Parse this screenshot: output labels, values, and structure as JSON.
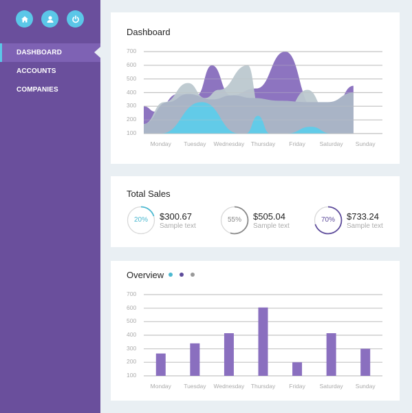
{
  "sidebar": {
    "icons": [
      {
        "name": "home-icon"
      },
      {
        "name": "user-icon"
      },
      {
        "name": "power-icon"
      }
    ],
    "items": [
      {
        "label": "DASHBOARD",
        "active": true
      },
      {
        "label": "ACCOUNTS",
        "active": false
      },
      {
        "label": "COMPANIES",
        "active": false
      }
    ]
  },
  "colors": {
    "sidebar": "#6a4f9c",
    "accent_cyan": "#5bc7e8",
    "purple": "#8d74c0",
    "grey_blue": "#a9b4c6",
    "light_grey_blue": "#bcc8cf"
  },
  "dashboard": {
    "title": "Dashboard"
  },
  "total_sales": {
    "title": "Total Sales",
    "stats": [
      {
        "percent": 20,
        "percent_label": "20%",
        "value": "$300.67",
        "sub": "Sample text",
        "color": "#4ab8d0"
      },
      {
        "percent": 55,
        "percent_label": "55%",
        "value": "$505.04",
        "sub": "Sample text",
        "color": "#888888"
      },
      {
        "percent": 70,
        "percent_label": "70%",
        "value": "$733.24",
        "sub": "Sample text",
        "color": "#5c4a9a"
      }
    ]
  },
  "overview": {
    "title": "Overview",
    "legend_dots": [
      {
        "color": "#4ab8d0"
      },
      {
        "color": "#5c4a9a"
      },
      {
        "color": "#999999"
      }
    ]
  },
  "chart_data": [
    {
      "type": "area",
      "title": "Dashboard",
      "categories": [
        "Monday",
        "Tuesday",
        "Wednesday",
        "Thursday",
        "Friday",
        "Saturday",
        "Sunday"
      ],
      "yticks": [
        700,
        600,
        500,
        400,
        300,
        200,
        100
      ],
      "ylim": [
        100,
        700
      ],
      "grid": true,
      "series": [
        {
          "name": "purple",
          "color": "#8d74c0",
          "x": [
            0,
            0.35,
            1,
            1.55,
            2,
            2.55,
            3.3,
            4.15,
            5,
            5.5,
            6.15
          ],
          "values": [
            300,
            260,
            390,
            380,
            600,
            380,
            430,
            700,
            280,
            250,
            450
          ]
        },
        {
          "name": "light",
          "color": "#bcc8cf",
          "x": [
            0,
            0.6,
            1.3,
            1.8,
            2.2,
            3.05,
            3.4,
            4.1,
            4.8,
            5.4,
            6.15
          ],
          "values": [
            170,
            330,
            470,
            360,
            420,
            600,
            280,
            250,
            420,
            250,
            400
          ]
        },
        {
          "name": "greyblue",
          "color": "#a9b4c6",
          "x": [
            0,
            0.7,
            1.3,
            2,
            2.6,
            3.2,
            4,
            4.8,
            5.4,
            6.15
          ],
          "values": [
            170,
            330,
            390,
            350,
            380,
            360,
            340,
            330,
            330,
            400
          ]
        },
        {
          "name": "cyan",
          "color": "#62cbe8",
          "x": [
            0.5,
            1.7,
            2.8,
            3.0,
            3.35,
            3.7,
            4.2,
            4.9,
            5.5
          ],
          "values": [
            100,
            330,
            100,
            100,
            230,
            100,
            100,
            150,
            100
          ]
        }
      ]
    },
    {
      "type": "bar",
      "title": "Overview",
      "categories": [
        "Monday",
        "Tuesday",
        "Wednesday",
        "Thursday",
        "Friday",
        "Saturday",
        "Sunday"
      ],
      "values": [
        265,
        340,
        415,
        605,
        200,
        415,
        300
      ],
      "yticks": [
        700,
        600,
        500,
        400,
        300,
        200,
        100
      ],
      "ylim": [
        100,
        700
      ],
      "grid": true,
      "color": "#8a6fbf"
    }
  ]
}
